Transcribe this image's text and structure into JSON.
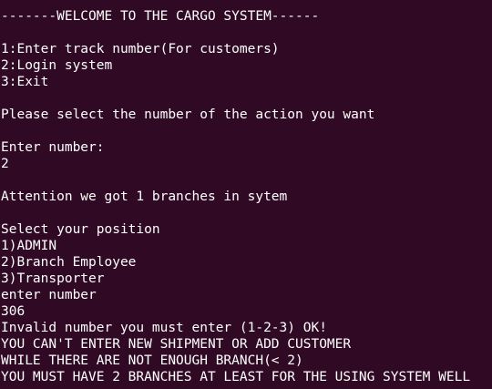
{
  "terminal": {
    "background_color": "#300a24",
    "text_color": "#ffffff",
    "lines": [
      "-------WELCOME TO THE CARGO SYSTEM------",
      "",
      "1:Enter track number(For customers)",
      "2:Login system",
      "3:Exit",
      "",
      "Please select the number of the action you want",
      "",
      "Enter number:",
      "2",
      "",
      "Attention we got 1 branches in sytem",
      "",
      "Select your position",
      "1)ADMIN",
      "2)Branch Employee",
      "3)Transporter",
      "enter number",
      "306",
      "Invalid number you must enter (1-2-3) OK!",
      "YOU CAN'T ENTER NEW SHIPMENT OR ADD CUSTOMER",
      "WHILE THERE ARE NOT ENOUGH BRANCH(< 2)",
      "YOU MUST HAVE 2 BRANCHES AT LEAST FOR THE USING SYSTEM WELL"
    ]
  }
}
